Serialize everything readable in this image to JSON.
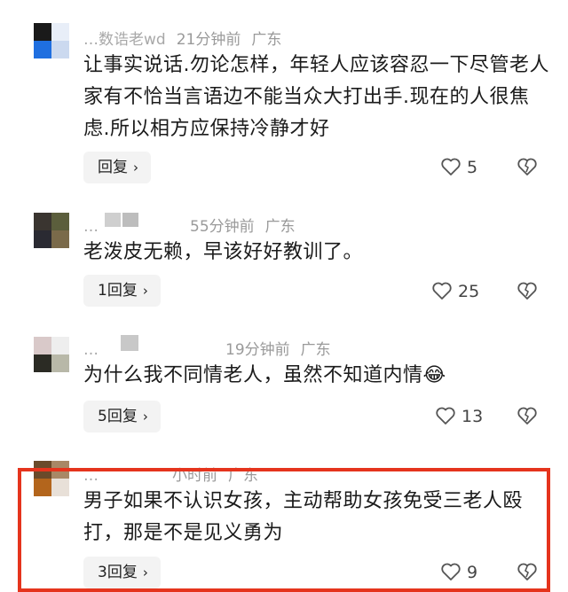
{
  "comments": [
    {
      "username": "…数诰老wd",
      "time": "21分钟前",
      "location": "广东",
      "text": "让事实说话.勿论怎样，年轻人应该容忍一下尽管老人家有不恰当言语边不能当众大打出手.现在的人很焦虑.所以相方应保持冷静才好",
      "reply_label": "回复",
      "likes": "5"
    },
    {
      "username": "…",
      "time": "55分钟前",
      "location": "广东",
      "text": "老泼皮无赖，早该好好教训了。",
      "reply_label": "1回复",
      "likes": "25"
    },
    {
      "username": "…",
      "time": "19分钟前",
      "location": "广东",
      "text": "为什么我不同情老人，虽然不知道内情😂",
      "reply_label": "5回复",
      "likes": "13"
    },
    {
      "username": "…",
      "time": "小时前",
      "location": "广东",
      "text": "男子如果不认识女孩，主动帮助女孩免受三老人殴打，那是不是见义勇为",
      "reply_label": "3回复",
      "likes": "9"
    }
  ],
  "icons": {
    "like": "heart-outline-icon",
    "dislike": "broken-heart-icon",
    "reply_chevron": "chevron-right-icon"
  },
  "colors": {
    "highlight": "#e5341d",
    "meta_text": "#9a9a9a",
    "reply_bg": "#f3f3f3"
  }
}
